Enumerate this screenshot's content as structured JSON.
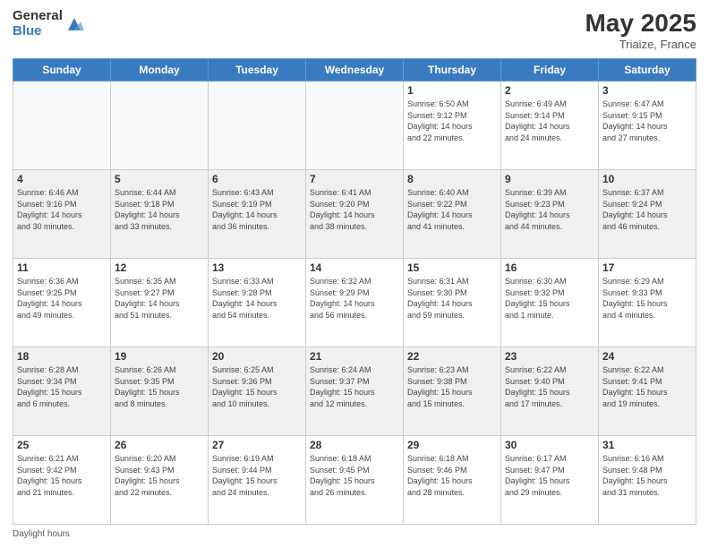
{
  "logo": {
    "general": "General",
    "blue": "Blue"
  },
  "title": "May 2025",
  "subtitle": "Triaize, France",
  "days_of_week": [
    "Sunday",
    "Monday",
    "Tuesday",
    "Wednesday",
    "Thursday",
    "Friday",
    "Saturday"
  ],
  "footer": "Daylight hours",
  "weeks": [
    [
      {
        "day": "",
        "detail": ""
      },
      {
        "day": "",
        "detail": ""
      },
      {
        "day": "",
        "detail": ""
      },
      {
        "day": "",
        "detail": ""
      },
      {
        "day": "1",
        "detail": "Sunrise: 6:50 AM\nSunset: 9:12 PM\nDaylight: 14 hours\nand 22 minutes."
      },
      {
        "day": "2",
        "detail": "Sunrise: 6:49 AM\nSunset: 9:14 PM\nDaylight: 14 hours\nand 24 minutes."
      },
      {
        "day": "3",
        "detail": "Sunrise: 6:47 AM\nSunset: 9:15 PM\nDaylight: 14 hours\nand 27 minutes."
      }
    ],
    [
      {
        "day": "4",
        "detail": "Sunrise: 6:46 AM\nSunset: 9:16 PM\nDaylight: 14 hours\nand 30 minutes."
      },
      {
        "day": "5",
        "detail": "Sunrise: 6:44 AM\nSunset: 9:18 PM\nDaylight: 14 hours\nand 33 minutes."
      },
      {
        "day": "6",
        "detail": "Sunrise: 6:43 AM\nSunset: 9:19 PM\nDaylight: 14 hours\nand 36 minutes."
      },
      {
        "day": "7",
        "detail": "Sunrise: 6:41 AM\nSunset: 9:20 PM\nDaylight: 14 hours\nand 38 minutes."
      },
      {
        "day": "8",
        "detail": "Sunrise: 6:40 AM\nSunset: 9:22 PM\nDaylight: 14 hours\nand 41 minutes."
      },
      {
        "day": "9",
        "detail": "Sunrise: 6:39 AM\nSunset: 9:23 PM\nDaylight: 14 hours\nand 44 minutes."
      },
      {
        "day": "10",
        "detail": "Sunrise: 6:37 AM\nSunset: 9:24 PM\nDaylight: 14 hours\nand 46 minutes."
      }
    ],
    [
      {
        "day": "11",
        "detail": "Sunrise: 6:36 AM\nSunset: 9:25 PM\nDaylight: 14 hours\nand 49 minutes."
      },
      {
        "day": "12",
        "detail": "Sunrise: 6:35 AM\nSunset: 9:27 PM\nDaylight: 14 hours\nand 51 minutes."
      },
      {
        "day": "13",
        "detail": "Sunrise: 6:33 AM\nSunset: 9:28 PM\nDaylight: 14 hours\nand 54 minutes."
      },
      {
        "day": "14",
        "detail": "Sunrise: 6:32 AM\nSunset: 9:29 PM\nDaylight: 14 hours\nand 56 minutes."
      },
      {
        "day": "15",
        "detail": "Sunrise: 6:31 AM\nSunset: 9:30 PM\nDaylight: 14 hours\nand 59 minutes."
      },
      {
        "day": "16",
        "detail": "Sunrise: 6:30 AM\nSunset: 9:32 PM\nDaylight: 15 hours\nand 1 minute."
      },
      {
        "day": "17",
        "detail": "Sunrise: 6:29 AM\nSunset: 9:33 PM\nDaylight: 15 hours\nand 4 minutes."
      }
    ],
    [
      {
        "day": "18",
        "detail": "Sunrise: 6:28 AM\nSunset: 9:34 PM\nDaylight: 15 hours\nand 6 minutes."
      },
      {
        "day": "19",
        "detail": "Sunrise: 6:26 AM\nSunset: 9:35 PM\nDaylight: 15 hours\nand 8 minutes."
      },
      {
        "day": "20",
        "detail": "Sunrise: 6:25 AM\nSunset: 9:36 PM\nDaylight: 15 hours\nand 10 minutes."
      },
      {
        "day": "21",
        "detail": "Sunrise: 6:24 AM\nSunset: 9:37 PM\nDaylight: 15 hours\nand 12 minutes."
      },
      {
        "day": "22",
        "detail": "Sunrise: 6:23 AM\nSunset: 9:38 PM\nDaylight: 15 hours\nand 15 minutes."
      },
      {
        "day": "23",
        "detail": "Sunrise: 6:22 AM\nSunset: 9:40 PM\nDaylight: 15 hours\nand 17 minutes."
      },
      {
        "day": "24",
        "detail": "Sunrise: 6:22 AM\nSunset: 9:41 PM\nDaylight: 15 hours\nand 19 minutes."
      }
    ],
    [
      {
        "day": "25",
        "detail": "Sunrise: 6:21 AM\nSunset: 9:42 PM\nDaylight: 15 hours\nand 21 minutes."
      },
      {
        "day": "26",
        "detail": "Sunrise: 6:20 AM\nSunset: 9:43 PM\nDaylight: 15 hours\nand 22 minutes."
      },
      {
        "day": "27",
        "detail": "Sunrise: 6:19 AM\nSunset: 9:44 PM\nDaylight: 15 hours\nand 24 minutes."
      },
      {
        "day": "28",
        "detail": "Sunrise: 6:18 AM\nSunset: 9:45 PM\nDaylight: 15 hours\nand 26 minutes."
      },
      {
        "day": "29",
        "detail": "Sunrise: 6:18 AM\nSunset: 9:46 PM\nDaylight: 15 hours\nand 28 minutes."
      },
      {
        "day": "30",
        "detail": "Sunrise: 6:17 AM\nSunset: 9:47 PM\nDaylight: 15 hours\nand 29 minutes."
      },
      {
        "day": "31",
        "detail": "Sunrise: 6:16 AM\nSunset: 9:48 PM\nDaylight: 15 hours\nand 31 minutes."
      }
    ]
  ]
}
